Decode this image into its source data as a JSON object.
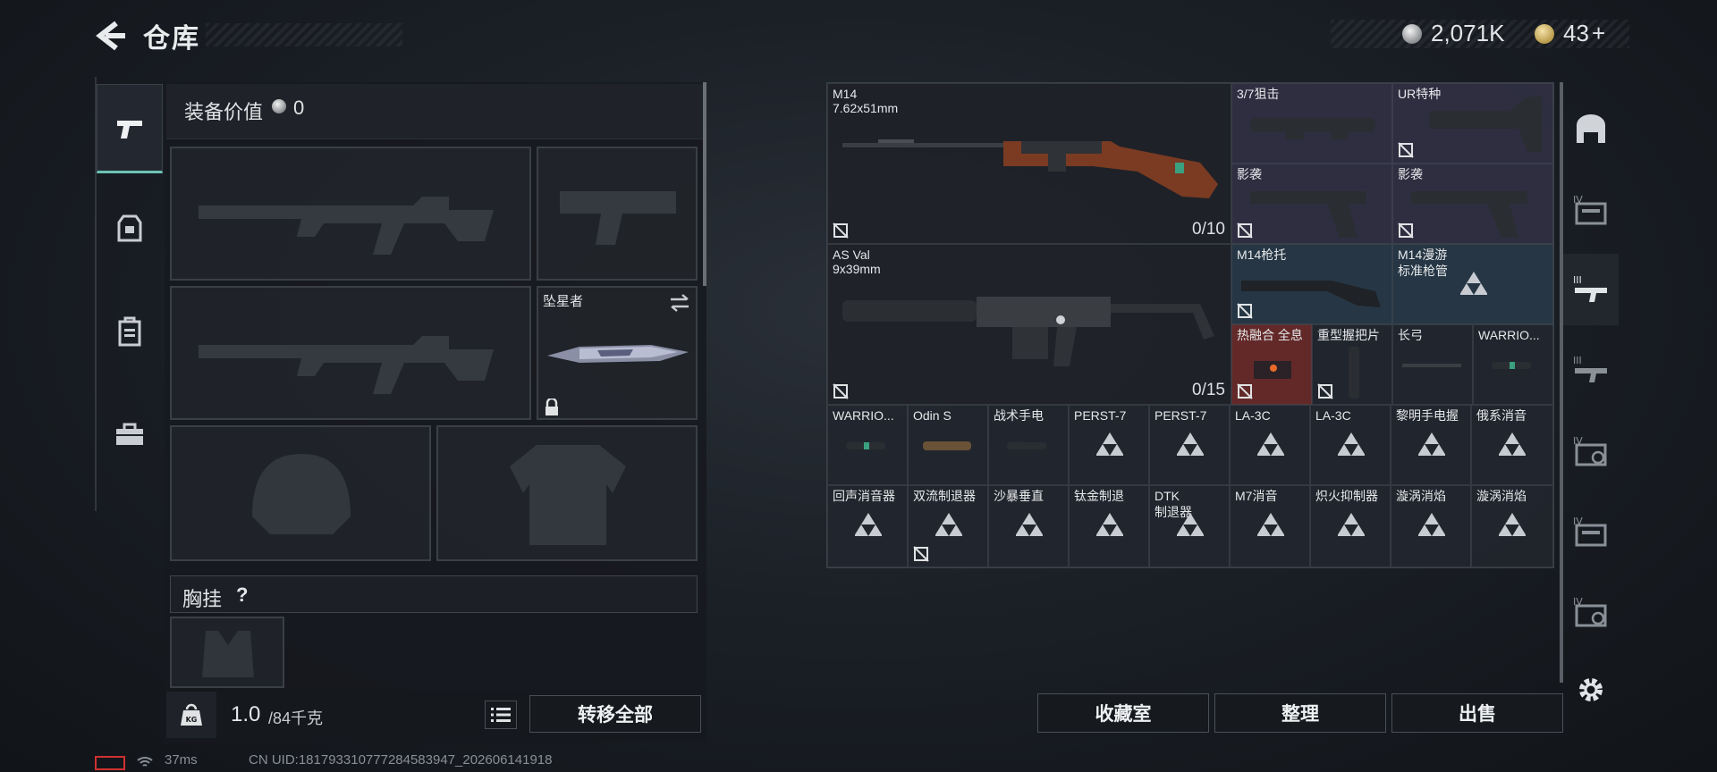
{
  "header": {
    "title": "仓库",
    "silver": "2,071K",
    "gold": "43",
    "gold_plus": "+"
  },
  "left_panel": {
    "equip_value_label": "装备价值",
    "equip_value": "0",
    "melee_name": "坠星者",
    "chest_label": "胸挂",
    "chest_help": "?",
    "weight_current": "1.0",
    "weight_max": "/84千克",
    "transfer_all": "转移全部"
  },
  "grid": {
    "m14": {
      "name": "M14",
      "caliber": "7.62x51mm",
      "count": "0/10"
    },
    "asval": {
      "name": "AS Val",
      "caliber": "9x39mm",
      "count": "0/15"
    },
    "cells": [
      {
        "name": "3/7狙击",
        "tint": "purple"
      },
      {
        "name": "UR特种",
        "tint": "purple"
      },
      {
        "name": "影袭",
        "tint": "purple"
      },
      {
        "name": "影袭",
        "tint": "purple"
      },
      {
        "name": "M14枪托",
        "tint": "blue"
      },
      {
        "name": "M14漫游",
        "name2": "标准枪管",
        "tint": "blue"
      },
      {
        "name": "热融合 全息",
        "tint": "red"
      },
      {
        "name": "重型握把片",
        "tint": "grey"
      },
      {
        "name": "长弓",
        "tint": "grey"
      },
      {
        "name": "WARRIO...",
        "tint": "grey"
      },
      {
        "name": "WARRIO...",
        "tint": "grey"
      },
      {
        "name": "Odin S",
        "tint": "grey"
      },
      {
        "name": "战术手电",
        "tint": "grey"
      },
      {
        "name": "PERST-7",
        "tint": "grey"
      },
      {
        "name": "PERST-7",
        "tint": "grey"
      },
      {
        "name": "LA-3C",
        "tint": "grey"
      },
      {
        "name": "LA-3C",
        "tint": "grey"
      },
      {
        "name": "黎明手电握",
        "tint": "grey"
      },
      {
        "name": "俄系消音",
        "tint": "grey"
      },
      {
        "name": "回声消音器",
        "tint": "grey"
      },
      {
        "name": "双流制退器",
        "tint": "grey"
      },
      {
        "name": "沙暴垂直",
        "tint": "grey"
      },
      {
        "name": "钛金制退",
        "tint": "grey"
      },
      {
        "name": "DTK",
        "name2": "制退器",
        "tint": "grey"
      },
      {
        "name": "M7消音",
        "tint": "grey"
      },
      {
        "name": "炽火抑制器",
        "tint": "grey"
      },
      {
        "name": "漩涡消焰",
        "tint": "grey"
      },
      {
        "name": "漩涡消焰",
        "tint": "grey"
      }
    ]
  },
  "buttons": {
    "collection": "收藏室",
    "sort": "整理",
    "sell": "出售"
  },
  "right_nav": {
    "tiers": [
      "IV",
      "III",
      "III",
      "IV",
      "IV",
      "IV"
    ]
  },
  "status": {
    "ping": "37ms",
    "uid": "CN UID:181793310777284583947_202606141918"
  },
  "colors": {
    "accent": "#6cc3b4",
    "purple_tint": "#34324a",
    "blue_tint": "#283c4c",
    "red_tint": "#6e2a28"
  }
}
